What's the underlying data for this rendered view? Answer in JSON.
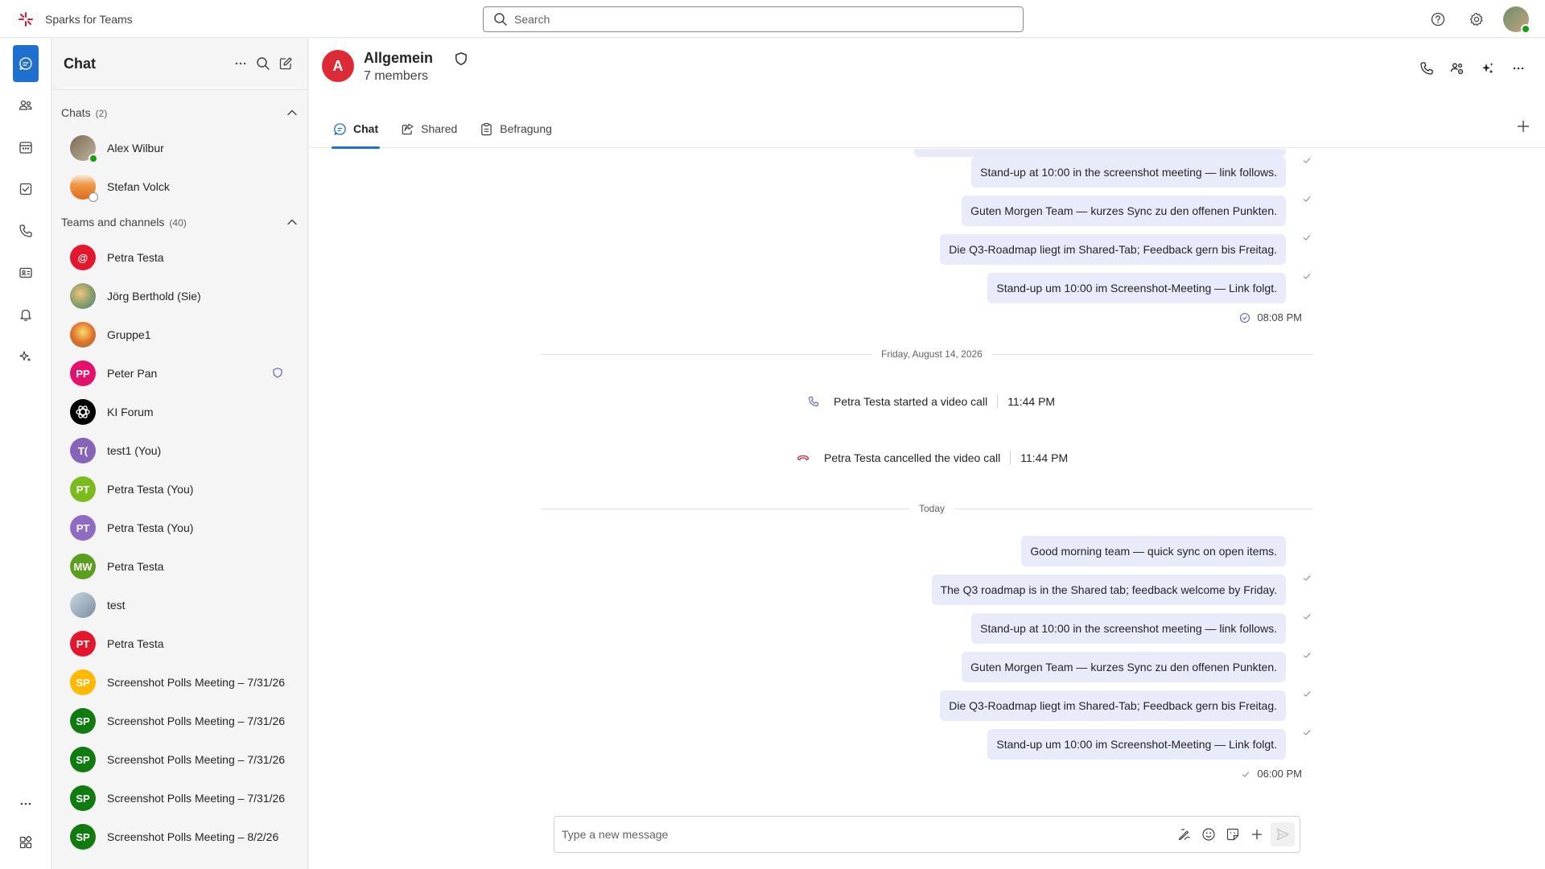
{
  "app": {
    "title": "Sparks for Teams"
  },
  "search": {
    "placeholder": "Search"
  },
  "sidebar": {
    "title": "Chat",
    "chats_section": {
      "label": "Chats",
      "count": "(2)"
    },
    "chats": [
      {
        "name": "Alex Wilbur"
      },
      {
        "name": "Stefan Volck"
      }
    ],
    "teams_section": {
      "label": "Teams and channels",
      "count": "(40)"
    },
    "channels": [
      {
        "name": "Petra Testa",
        "initials": "@",
        "color": "#e3172e"
      },
      {
        "name": "Jörg Berthold (Sie)",
        "initials": "",
        "color": "#b5a27a"
      },
      {
        "name": "Gruppe1",
        "initials": "",
        "color": "#e9a23b"
      },
      {
        "name": "Peter Pan",
        "initials": "PP",
        "color": "#e3106c"
      },
      {
        "name": "KI Forum",
        "initials": "",
        "color": "#000000"
      },
      {
        "name": "test1 (You)",
        "initials": "T(",
        "color": "#8764b8"
      },
      {
        "name": "Petra Testa (You)",
        "initials": "PT",
        "color": "#7bbb1e"
      },
      {
        "name": "Petra Testa (You)",
        "initials": "PT",
        "color": "#8f6cc1"
      },
      {
        "name": "Petra Testa",
        "initials": "MW",
        "color": "#5c9e1e"
      },
      {
        "name": "test",
        "initials": "",
        "color": "#a4b8c8"
      },
      {
        "name": "Petra Testa",
        "initials": "PT",
        "color": "#e3172e"
      },
      {
        "name": "Screenshot Polls Meeting – 7/31/26",
        "initials": "SP",
        "color": "#ffb900"
      },
      {
        "name": "Screenshot Polls Meeting – 7/31/26",
        "initials": "SP",
        "color": "#107c10"
      },
      {
        "name": "Screenshot Polls Meeting – 7/31/26",
        "initials": "SP",
        "color": "#107c10"
      },
      {
        "name": "Screenshot Polls Meeting – 7/31/26",
        "initials": "SP",
        "color": "#107c10"
      },
      {
        "name": "Screenshot Polls Meeting – 8/2/26",
        "initials": "SP",
        "color": "#107c10"
      }
    ]
  },
  "channel": {
    "initial": "A",
    "name": "Allgemein",
    "members": "7 members",
    "tabs": [
      {
        "label": "Chat"
      },
      {
        "label": "Shared"
      },
      {
        "label": "Befragung"
      }
    ]
  },
  "messages": {
    "earlier": [
      "Stand-up at 10:00 in the screenshot meeting — link follows.",
      "Guten Morgen Team — kurzes Sync zu den offenen Punkten.",
      "Die Q3-Roadmap liegt im Shared-Tab; Feedback gern bis Freitag.",
      "Stand-up um 10:00 im Screenshot-Meeting — Link folgt."
    ],
    "earlier_time": "08:08 PM",
    "date_divider": "Friday, August 14, 2026",
    "call_started": {
      "text": "Petra Testa started a video call",
      "time": "11:44 PM"
    },
    "call_cancelled": {
      "text": "Petra Testa cancelled the video call",
      "time": "11:44 PM"
    },
    "today_divider": "Today",
    "today": [
      "Good morning team — quick sync on open items.",
      "The Q3 roadmap is in the Shared tab; feedback welcome by Friday.",
      "Stand-up at 10:00 in the screenshot meeting — link follows.",
      "Guten Morgen Team — kurzes Sync zu den offenen Punkten.",
      "Die Q3-Roadmap liegt im Shared-Tab; Feedback gern bis Freitag.",
      "Stand-up um 10:00 im Screenshot-Meeting — Link folgt."
    ],
    "today_time": "06:00 PM"
  },
  "composer": {
    "placeholder": "Type a new message"
  },
  "colors": {
    "accent": "#1f6fcf",
    "bubble": "#e8ebfa",
    "brand": "#e3172e"
  }
}
